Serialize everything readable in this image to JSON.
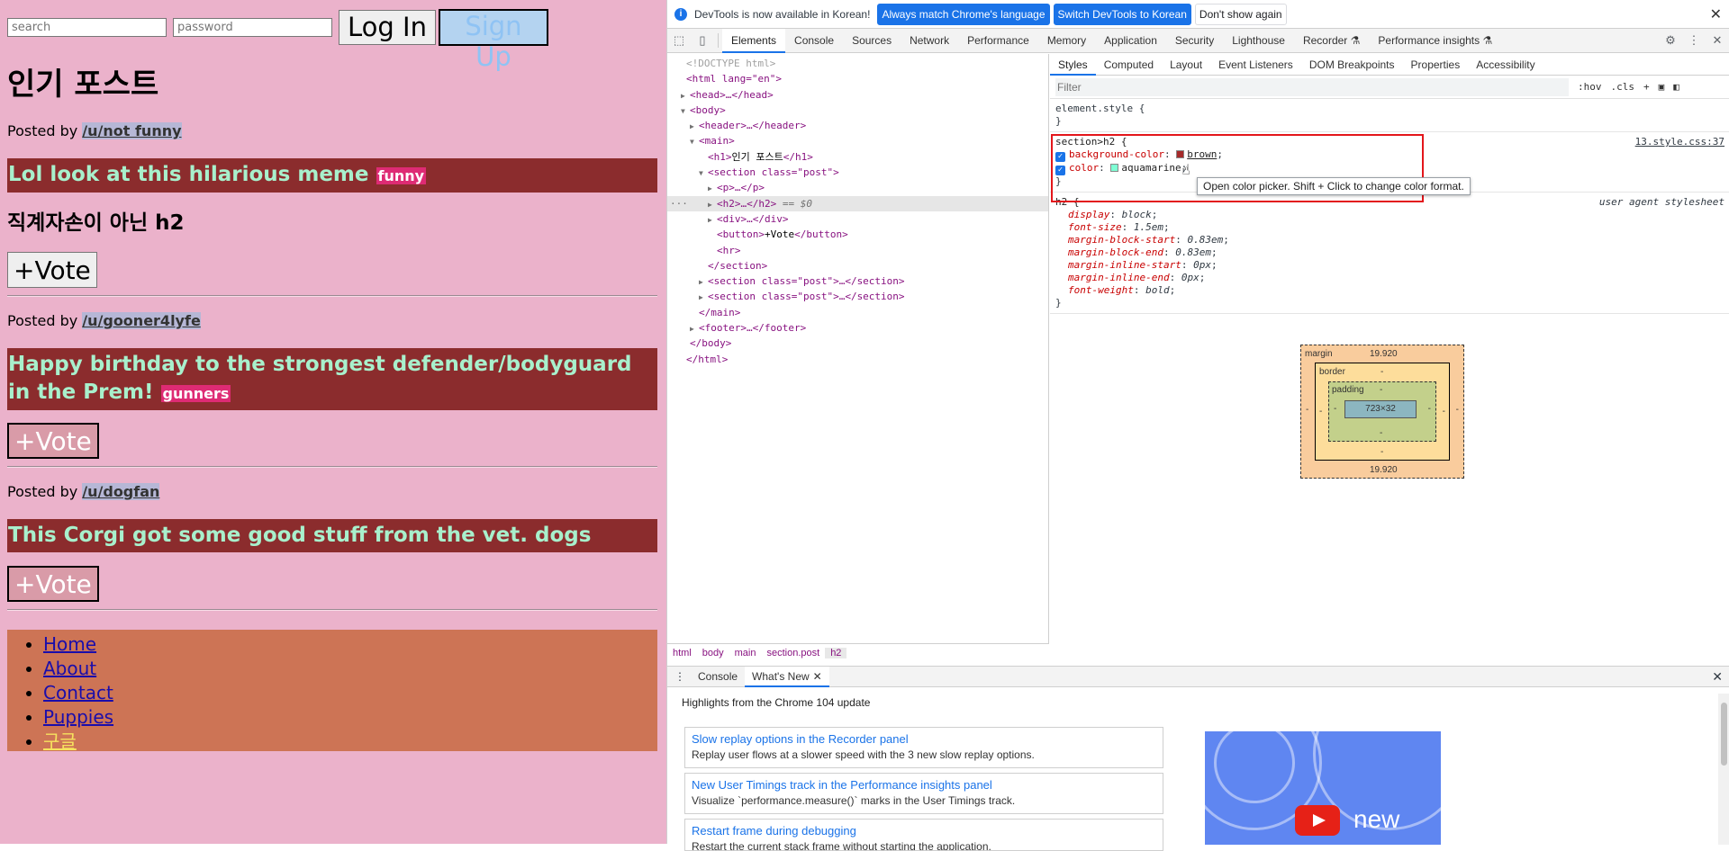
{
  "page": {
    "auth": {
      "search_placeholder": "search",
      "password_placeholder": "password",
      "login_label": "Log In",
      "signup_label": "Sign Up"
    },
    "title": "인기 포스트",
    "posts": [
      {
        "posted_by": "Posted by",
        "user": "/u/not funny",
        "title": "Lol look at this hilarious meme",
        "tag": "funny",
        "subheading": "직계자손이 아닌 h2",
        "vote_label": "+Vote"
      },
      {
        "posted_by": "Posted by",
        "user": "/u/gooner4lyfe",
        "title": "Happy birthday to the strongest defender/bodyguard in the Prem!",
        "tag": "gunners",
        "vote_label": "+Vote"
      },
      {
        "posted_by": "Posted by",
        "user": "/u/dogfan",
        "title": "This Corgi got some good stuff from the vet.",
        "tag": "dogs",
        "vote_label": "+Vote"
      }
    ],
    "footer_links": [
      "Home",
      "About",
      "Contact",
      "Puppies",
      "구글"
    ]
  },
  "devtools": {
    "infobar": {
      "message": "DevTools is now available in Korean!",
      "btn_match": "Always match Chrome's language",
      "btn_switch": "Switch DevTools to Korean",
      "btn_dismiss": "Don't show again"
    },
    "tabs": [
      "Elements",
      "Console",
      "Sources",
      "Network",
      "Performance",
      "Memory",
      "Application",
      "Security",
      "Lighthouse",
      "Recorder ⚗",
      "Performance insights ⚗"
    ],
    "dom": {
      "doctype": "<!DOCTYPE html>",
      "html_open": "<html lang=\"en\">",
      "head": "<head>…</head>",
      "body_open": "<body>",
      "header": "<header>…</header>",
      "main_open": "<main>",
      "h1_open": "<h1>",
      "h1_text": "인기 포스트",
      "h1_close": "</h1>",
      "section_open": "<section class=\"post\">",
      "p": "<p>…</p>",
      "h2": "<h2>…</h2>",
      "h2_eq": "== $0",
      "div": "<div>…</div>",
      "button_open": "<button>",
      "button_text": "+Vote",
      "button_close": "</button>",
      "hr": "<hr>",
      "section_close": "</section>",
      "section2": "<section class=\"post\">…</section>",
      "section3": "<section class=\"post\">…</section>",
      "main_close": "</main>",
      "footer": "<footer>…</footer>",
      "body_close": "</body>",
      "html_close": "</html>",
      "dots": "···"
    },
    "breadcrumbs": [
      "html",
      "body",
      "main",
      "section.post",
      "h2"
    ],
    "styles_tabs": [
      "Styles",
      "Computed",
      "Layout",
      "Event Listeners",
      "DOM Breakpoints",
      "Properties",
      "Accessibility"
    ],
    "filter_placeholder": "Filter",
    "filter_hov": ":hov",
    "filter_cls": ".cls",
    "element_style": "element.style {",
    "rule_close": "}",
    "rule1": {
      "selector": "section>h2 {",
      "source": "13.style.css:37",
      "prop1": "background-color",
      "val1": "brown",
      "prop2": "color",
      "val2": "aquamarine",
      "swatch1": "#a52a2a",
      "swatch2": "#7fffd4"
    },
    "tooltip": "Open color picker. Shift + Click to change color format.",
    "ua_rule": {
      "selector": "h2 {",
      "source": "user agent stylesheet",
      "props": [
        {
          "p": "display",
          "v": "block"
        },
        {
          "p": "font-size",
          "v": "1.5em"
        },
        {
          "p": "margin-block-start",
          "v": "0.83em"
        },
        {
          "p": "margin-block-end",
          "v": "0.83em"
        },
        {
          "p": "margin-inline-start",
          "v": "0px"
        },
        {
          "p": "margin-inline-end",
          "v": "0px"
        },
        {
          "p": "font-weight",
          "v": "bold"
        }
      ]
    },
    "boxmodel": {
      "margin_label": "margin",
      "margin_top": "19.920",
      "margin_bottom": "19.920",
      "margin_side": "-",
      "border_label": "border",
      "border_val": "-",
      "padding_label": "padding",
      "padding_val": "-",
      "content": "723×32"
    },
    "drawer": {
      "tab_console": "Console",
      "tab_whatsnew": "What's New",
      "highlights": "Highlights from the Chrome 104 update",
      "cards": [
        {
          "title": "Slow replay options in the Recorder panel",
          "desc": "Replay user flows at a slower speed with the 3 new slow replay options."
        },
        {
          "title": "New User Timings track in the Performance insights panel",
          "desc": "Visualize `performance.measure()` marks in the User Timings track."
        },
        {
          "title": "Restart frame during debugging",
          "desc": "Restart the current stack frame without starting the application."
        }
      ],
      "video_text": "new"
    }
  }
}
